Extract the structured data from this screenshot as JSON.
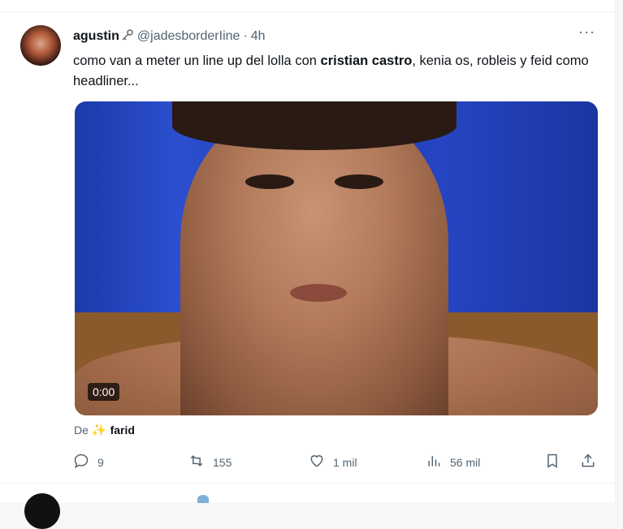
{
  "tweet": {
    "display_name": "agustin",
    "handle": "@jadesborderIine",
    "separator": "·",
    "time": "4h",
    "more_glyph": "···",
    "text_before": "como van a meter un line up del lolla con ",
    "text_bold": "cristian castro",
    "text_after": ", kenia os, robleis y feid como headliner...",
    "media": {
      "timestamp": "0:00"
    },
    "attribution": {
      "prefix": "De",
      "from_name": "farid"
    },
    "actions": {
      "replies": "9",
      "retweets": "155",
      "likes": "1 mil",
      "views": "56 mil"
    }
  },
  "colors": {
    "accent": "#1d9bf0",
    "muted": "#536471",
    "spark": "#f6b21b"
  }
}
